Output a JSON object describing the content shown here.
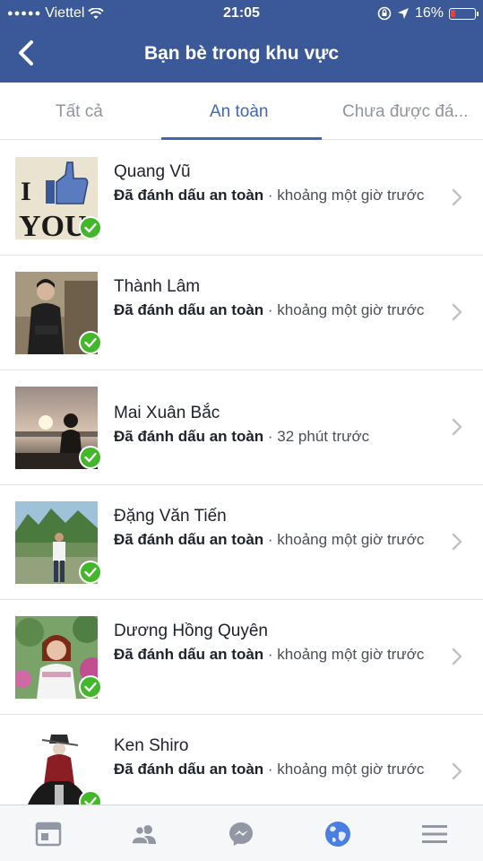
{
  "status_bar": {
    "carrier": "Viettel",
    "time": "21:05",
    "battery": "16%",
    "battery_level": 0.16
  },
  "header": {
    "title": "Bạn bè trong khu vực"
  },
  "tabs": [
    {
      "label": "Tất cả",
      "active": false
    },
    {
      "label": "An toàn",
      "active": true
    },
    {
      "label": "Chưa được đá..."
    }
  ],
  "friends": [
    {
      "name": "Quang Vũ",
      "status_bold": "Đã đánh dấu an toàn",
      "status_rest": " · khoảng một giờ trước"
    },
    {
      "name": "Thành Lâm",
      "status_bold": "Đã đánh dấu an toàn",
      "status_rest": " · khoảng một giờ trước"
    },
    {
      "name": "Mai Xuân Bắc",
      "status_bold": "Đã đánh dấu an toàn",
      "status_rest": " · 32 phút trước"
    },
    {
      "name": "Đặng Văn Tiến",
      "status_bold": "Đã đánh dấu an toàn",
      "status_rest": " · khoảng một giờ trước"
    },
    {
      "name": "Dương Hồng Quyên",
      "status_bold": "Đã đánh dấu an toàn",
      "status_rest": " · khoảng một giờ trước"
    },
    {
      "name": "Ken Shiro",
      "status_bold": "Đã đánh dấu an toàn",
      "status_rest": " · khoảng một giờ trước"
    }
  ],
  "avatar_1_text": "I YOU",
  "colors": {
    "brand": "#3b5998",
    "active_tab": "#4267b2",
    "safe_check": "#42b72a"
  },
  "bottom_tabs": [
    "news-feed-icon",
    "friends-icon",
    "messenger-icon",
    "globe-icon",
    "menu-icon"
  ]
}
